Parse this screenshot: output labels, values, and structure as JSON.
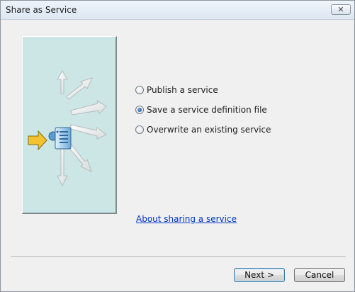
{
  "window": {
    "title": "Share as Service",
    "close_label": "✕"
  },
  "options": [
    {
      "label": "Publish a service",
      "checked": false
    },
    {
      "label": "Save a service definition file",
      "checked": true
    },
    {
      "label": "Overwrite an existing service",
      "checked": false
    }
  ],
  "link": {
    "label": "About sharing a service"
  },
  "buttons": {
    "next": "Next >",
    "cancel": "Cancel"
  },
  "illustration": {
    "icon": "share-service-arrows-icon"
  },
  "colors": {
    "illustration_bg": "#cce5e5",
    "arrow_in": "#f2c230",
    "link": "#0033cc"
  }
}
